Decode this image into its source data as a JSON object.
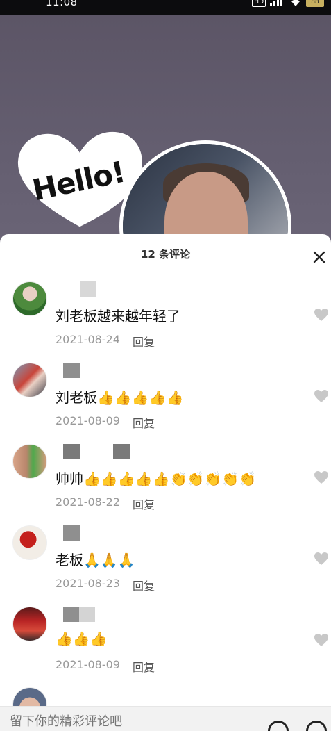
{
  "status_bar": {
    "time": "11:08",
    "hd": "HD",
    "battery": "88"
  },
  "video": {
    "sticker_text": "Hello!"
  },
  "comments_sheet": {
    "title": "12 条评论",
    "close_icon": "close-icon",
    "comments": [
      {
        "text": "刘老板越来越年轻了",
        "date": "2021-08-24",
        "reply": "回复"
      },
      {
        "text": "刘老板👍👍👍👍👍",
        "date": "2021-08-09",
        "reply": "回复"
      },
      {
        "text": "帅帅👍👍👍👍👍👏👏👏👏👏",
        "date": "2021-08-22",
        "reply": "回复"
      },
      {
        "text": "老板🙏🙏🙏",
        "date": "2021-08-23",
        "reply": "回复"
      },
      {
        "text": "👍👍👍",
        "date": "2021-08-09",
        "reply": "回复"
      }
    ]
  },
  "input_bar": {
    "placeholder": "留下你的精彩评论吧"
  },
  "colors": {
    "sheet_bg": "#ffffff",
    "meta_text": "#999999",
    "video_bg": "#5c5566"
  }
}
